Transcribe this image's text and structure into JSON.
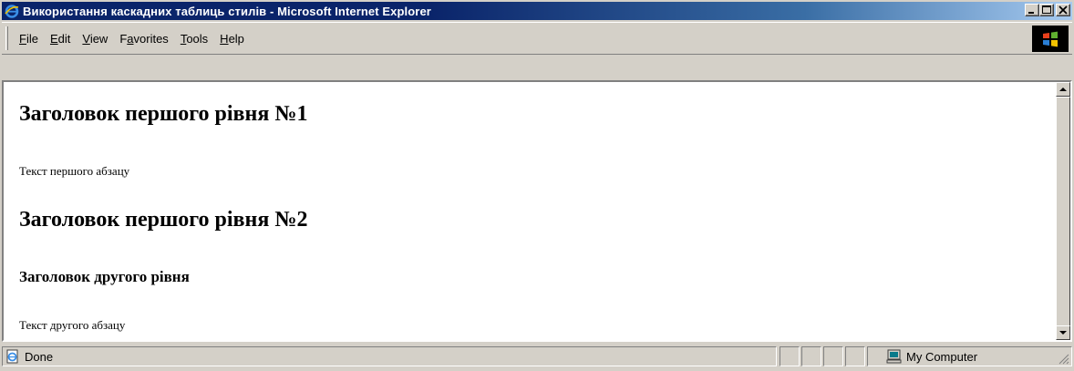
{
  "window": {
    "title": "Використання каскадних таблиць стилів - Microsoft Internet Explorer",
    "minimize_label": "_",
    "maximize_label": "□",
    "close_label": "×"
  },
  "menu": {
    "items": [
      {
        "prefix": "",
        "accel": "F",
        "rest": "ile"
      },
      {
        "prefix": "",
        "accel": "E",
        "rest": "dit"
      },
      {
        "prefix": "",
        "accel": "V",
        "rest": "iew"
      },
      {
        "prefix": "F",
        "accel": "a",
        "rest": "vorites"
      },
      {
        "prefix": "",
        "accel": "T",
        "rest": "ools"
      },
      {
        "prefix": "",
        "accel": "H",
        "rest": "elp"
      }
    ]
  },
  "page": {
    "heading1_a": "Заголовок першого рівня №1",
    "paragraph1": "Текст першого абзацу",
    "heading1_b": "Заголовок першого рівня №2",
    "heading2": "Заголовок другого рівня",
    "paragraph2": "Текст другого абзацу"
  },
  "status": {
    "text": "Done",
    "zone": "My Computer"
  },
  "icons": {
    "title": "ie-logo-icon",
    "throbber": "windows-logo-icon",
    "status": "ie-page-icon",
    "zone": "my-computer-icon"
  }
}
